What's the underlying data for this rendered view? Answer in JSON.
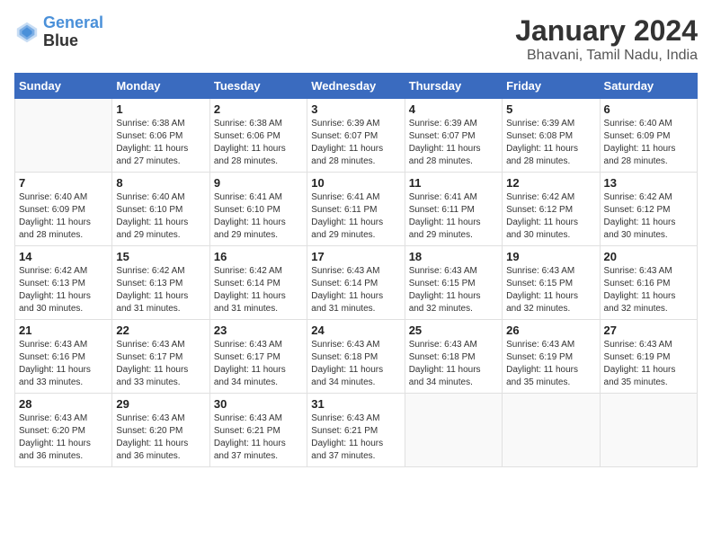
{
  "logo": {
    "text1": "General",
    "text2": "Blue"
  },
  "title": "January 2024",
  "subtitle": "Bhavani, Tamil Nadu, India",
  "days_header": [
    "Sunday",
    "Monday",
    "Tuesday",
    "Wednesday",
    "Thursday",
    "Friday",
    "Saturday"
  ],
  "weeks": [
    [
      {
        "day": "",
        "info": ""
      },
      {
        "day": "1",
        "info": "Sunrise: 6:38 AM\nSunset: 6:06 PM\nDaylight: 11 hours\nand 27 minutes."
      },
      {
        "day": "2",
        "info": "Sunrise: 6:38 AM\nSunset: 6:06 PM\nDaylight: 11 hours\nand 28 minutes."
      },
      {
        "day": "3",
        "info": "Sunrise: 6:39 AM\nSunset: 6:07 PM\nDaylight: 11 hours\nand 28 minutes."
      },
      {
        "day": "4",
        "info": "Sunrise: 6:39 AM\nSunset: 6:07 PM\nDaylight: 11 hours\nand 28 minutes."
      },
      {
        "day": "5",
        "info": "Sunrise: 6:39 AM\nSunset: 6:08 PM\nDaylight: 11 hours\nand 28 minutes."
      },
      {
        "day": "6",
        "info": "Sunrise: 6:40 AM\nSunset: 6:09 PM\nDaylight: 11 hours\nand 28 minutes."
      }
    ],
    [
      {
        "day": "7",
        "info": "Sunrise: 6:40 AM\nSunset: 6:09 PM\nDaylight: 11 hours\nand 28 minutes."
      },
      {
        "day": "8",
        "info": "Sunrise: 6:40 AM\nSunset: 6:10 PM\nDaylight: 11 hours\nand 29 minutes."
      },
      {
        "day": "9",
        "info": "Sunrise: 6:41 AM\nSunset: 6:10 PM\nDaylight: 11 hours\nand 29 minutes."
      },
      {
        "day": "10",
        "info": "Sunrise: 6:41 AM\nSunset: 6:11 PM\nDaylight: 11 hours\nand 29 minutes."
      },
      {
        "day": "11",
        "info": "Sunrise: 6:41 AM\nSunset: 6:11 PM\nDaylight: 11 hours\nand 29 minutes."
      },
      {
        "day": "12",
        "info": "Sunrise: 6:42 AM\nSunset: 6:12 PM\nDaylight: 11 hours\nand 30 minutes."
      },
      {
        "day": "13",
        "info": "Sunrise: 6:42 AM\nSunset: 6:12 PM\nDaylight: 11 hours\nand 30 minutes."
      }
    ],
    [
      {
        "day": "14",
        "info": "Sunrise: 6:42 AM\nSunset: 6:13 PM\nDaylight: 11 hours\nand 30 minutes."
      },
      {
        "day": "15",
        "info": "Sunrise: 6:42 AM\nSunset: 6:13 PM\nDaylight: 11 hours\nand 31 minutes."
      },
      {
        "day": "16",
        "info": "Sunrise: 6:42 AM\nSunset: 6:14 PM\nDaylight: 11 hours\nand 31 minutes."
      },
      {
        "day": "17",
        "info": "Sunrise: 6:43 AM\nSunset: 6:14 PM\nDaylight: 11 hours\nand 31 minutes."
      },
      {
        "day": "18",
        "info": "Sunrise: 6:43 AM\nSunset: 6:15 PM\nDaylight: 11 hours\nand 32 minutes."
      },
      {
        "day": "19",
        "info": "Sunrise: 6:43 AM\nSunset: 6:15 PM\nDaylight: 11 hours\nand 32 minutes."
      },
      {
        "day": "20",
        "info": "Sunrise: 6:43 AM\nSunset: 6:16 PM\nDaylight: 11 hours\nand 32 minutes."
      }
    ],
    [
      {
        "day": "21",
        "info": "Sunrise: 6:43 AM\nSunset: 6:16 PM\nDaylight: 11 hours\nand 33 minutes."
      },
      {
        "day": "22",
        "info": "Sunrise: 6:43 AM\nSunset: 6:17 PM\nDaylight: 11 hours\nand 33 minutes."
      },
      {
        "day": "23",
        "info": "Sunrise: 6:43 AM\nSunset: 6:17 PM\nDaylight: 11 hours\nand 34 minutes."
      },
      {
        "day": "24",
        "info": "Sunrise: 6:43 AM\nSunset: 6:18 PM\nDaylight: 11 hours\nand 34 minutes."
      },
      {
        "day": "25",
        "info": "Sunrise: 6:43 AM\nSunset: 6:18 PM\nDaylight: 11 hours\nand 34 minutes."
      },
      {
        "day": "26",
        "info": "Sunrise: 6:43 AM\nSunset: 6:19 PM\nDaylight: 11 hours\nand 35 minutes."
      },
      {
        "day": "27",
        "info": "Sunrise: 6:43 AM\nSunset: 6:19 PM\nDaylight: 11 hours\nand 35 minutes."
      }
    ],
    [
      {
        "day": "28",
        "info": "Sunrise: 6:43 AM\nSunset: 6:20 PM\nDaylight: 11 hours\nand 36 minutes."
      },
      {
        "day": "29",
        "info": "Sunrise: 6:43 AM\nSunset: 6:20 PM\nDaylight: 11 hours\nand 36 minutes."
      },
      {
        "day": "30",
        "info": "Sunrise: 6:43 AM\nSunset: 6:21 PM\nDaylight: 11 hours\nand 37 minutes."
      },
      {
        "day": "31",
        "info": "Sunrise: 6:43 AM\nSunset: 6:21 PM\nDaylight: 11 hours\nand 37 minutes."
      },
      {
        "day": "",
        "info": ""
      },
      {
        "day": "",
        "info": ""
      },
      {
        "day": "",
        "info": ""
      }
    ]
  ]
}
